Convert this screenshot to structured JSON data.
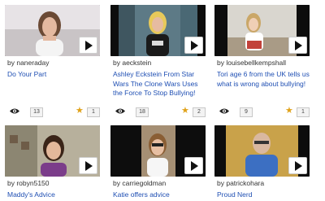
{
  "videos": [
    {
      "author": "by naneraday",
      "title": "Do Your Part",
      "views": "13",
      "favorites": "1",
      "play_icon": "play-icon"
    },
    {
      "author": "by aeckstein",
      "title": "Ashley Eckstein From Star Wars The Clone Wars Uses the Force To Stop Bullying!",
      "views": "18",
      "favorites": "2",
      "play_icon": "play-icon"
    },
    {
      "author": "by louisebellkempshall",
      "title": "Tori age 6 from the UK tells us what is wrong about bullying!",
      "views": "9",
      "favorites": "1",
      "play_icon": "play-icon"
    },
    {
      "author": "by robyn5150",
      "title": "Maddy's Advice",
      "play_icon": "play-icon"
    },
    {
      "author": "by carriegoldman",
      "title": "Katie offers advice",
      "play_icon": "play-icon"
    },
    {
      "author": "by patrickohara",
      "title": "Proud Nerd",
      "play_icon": "play-icon"
    }
  ],
  "colors": {
    "link": "#1f4fb3",
    "star": "#e0a21a",
    "thumb_bg": "#101010"
  }
}
